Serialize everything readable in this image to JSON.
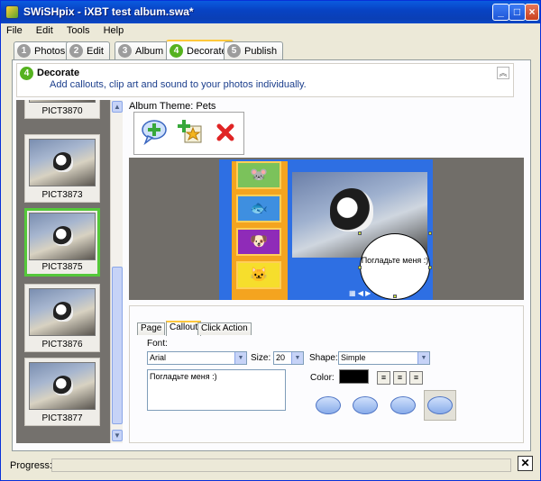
{
  "window": {
    "title": "SWiSHpix - iXBT test album.swa*"
  },
  "menu": [
    "File",
    "Edit",
    "Tools",
    "Help"
  ],
  "tabs": [
    {
      "num": "1",
      "label": "Photos"
    },
    {
      "num": "2",
      "label": "Edit"
    },
    {
      "num": "3",
      "label": "Album"
    },
    {
      "num": "4",
      "label": "Decorate"
    },
    {
      "num": "5",
      "label": "Publish"
    }
  ],
  "header": {
    "num": "4",
    "title": "Decorate",
    "description": "Add callouts, clip art and sound to your photos individually."
  },
  "album_theme": "Album Theme:  Pets",
  "thumbnails": [
    "PICT3870",
    "PICT3873",
    "PICT3875",
    "PICT3876",
    "PICT3877"
  ],
  "selected_thumbnail": "PICT3875",
  "stage": {
    "callout_text": "Погладьте меня :)"
  },
  "sub_tabs": [
    "Page",
    "Callout",
    "Click Action"
  ],
  "callout": {
    "font_label": "Font:",
    "font": "Arial",
    "size_label": "Size:",
    "size": "20",
    "shape_label": "Shape:",
    "shape": "Simple",
    "color_label": "Color:",
    "color": "#000000",
    "text": "Погладьте меня :)"
  },
  "status": {
    "progress_label": "Progress:"
  }
}
